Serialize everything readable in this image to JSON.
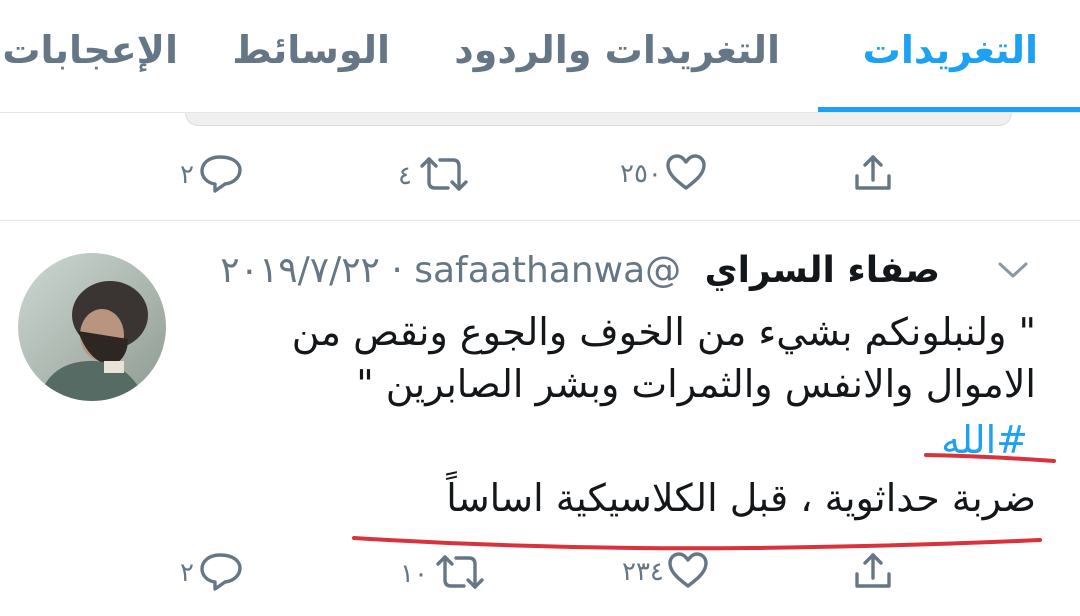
{
  "tabs": [
    {
      "label": "التغريدات",
      "active": true
    },
    {
      "label": "التغريدات والردود",
      "active": false
    },
    {
      "label": "الوسائط",
      "active": false
    },
    {
      "label": "الإعجابات",
      "active": false
    }
  ],
  "tweet1": {
    "actions": {
      "replies": "٢",
      "retweets": "٤",
      "likes": "٢٥٠"
    }
  },
  "tweet2": {
    "name": "صفاء السراي",
    "handle": "@safaathanwa",
    "date": "٢٠١٩/٧/٢٢",
    "separator": "·",
    "quote": "\" ولنبلونكم بشيء من الخوف والجوع ونقص من الاموال والانفس والثمرات وبشر الصابرين \"",
    "hashtag": "#الله",
    "comment": "ضربة حداثوية ، قبل الكلاسيكية اساساً",
    "actions": {
      "replies": "٢",
      "retweets": "١٠",
      "likes": "٢٣٤"
    }
  },
  "colors": {
    "accent": "#1da1f2",
    "muted": "#657786",
    "annotation": "#d9323c"
  },
  "icons": [
    "reply-icon",
    "retweet-icon",
    "like-icon",
    "share-icon",
    "chevron-down-icon"
  ]
}
